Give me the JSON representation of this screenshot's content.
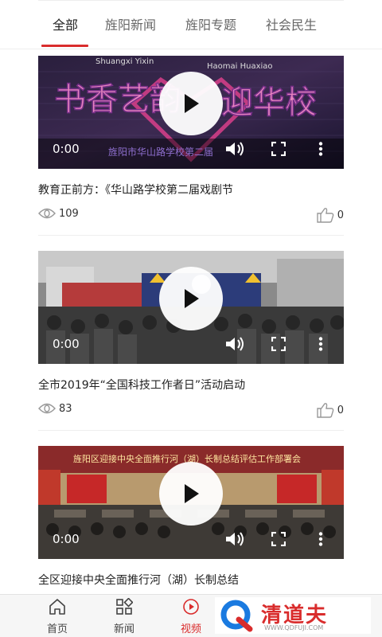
{
  "tabs": {
    "items": [
      {
        "label": "全部",
        "active": true
      },
      {
        "label": "旌阳新闻",
        "active": false
      },
      {
        "label": "旌阳专题",
        "active": false
      },
      {
        "label": "社会民生",
        "active": false
      }
    ]
  },
  "feed": {
    "videos": [
      {
        "title": "教育正前方：《华山路学校第二届戏剧节",
        "time": "0:00",
        "views": "109",
        "likes": "0",
        "overlay_top_left": "Shuangxi Yixin",
        "overlay_top_right": "Haomai Huaxiao",
        "overlay_bottom": "旌阳市华山路学校第二届"
      },
      {
        "title": "全市2019年“全国科技工作者日”活动启动",
        "time": "0:00",
        "views": "83",
        "likes": "0"
      },
      {
        "title": "全区迎接中央全面推行河（湖）长制总结",
        "time": "0:00",
        "banner": "旌阳区迎接中央全面推行河（湖）长制总结评估工作部署会"
      }
    ]
  },
  "bottom_nav": {
    "items": [
      {
        "label": "首页",
        "icon": "home-icon",
        "active": false
      },
      {
        "label": "新闻",
        "icon": "grid-icon",
        "active": false
      },
      {
        "label": "视频",
        "icon": "video-icon",
        "active": true
      }
    ]
  },
  "watermark": {
    "brand": "清道夫",
    "url": "WWW.QDFUJI.COM"
  },
  "colors": {
    "accent": "#d92c2c",
    "text": "#222222",
    "muted": "#666666"
  }
}
